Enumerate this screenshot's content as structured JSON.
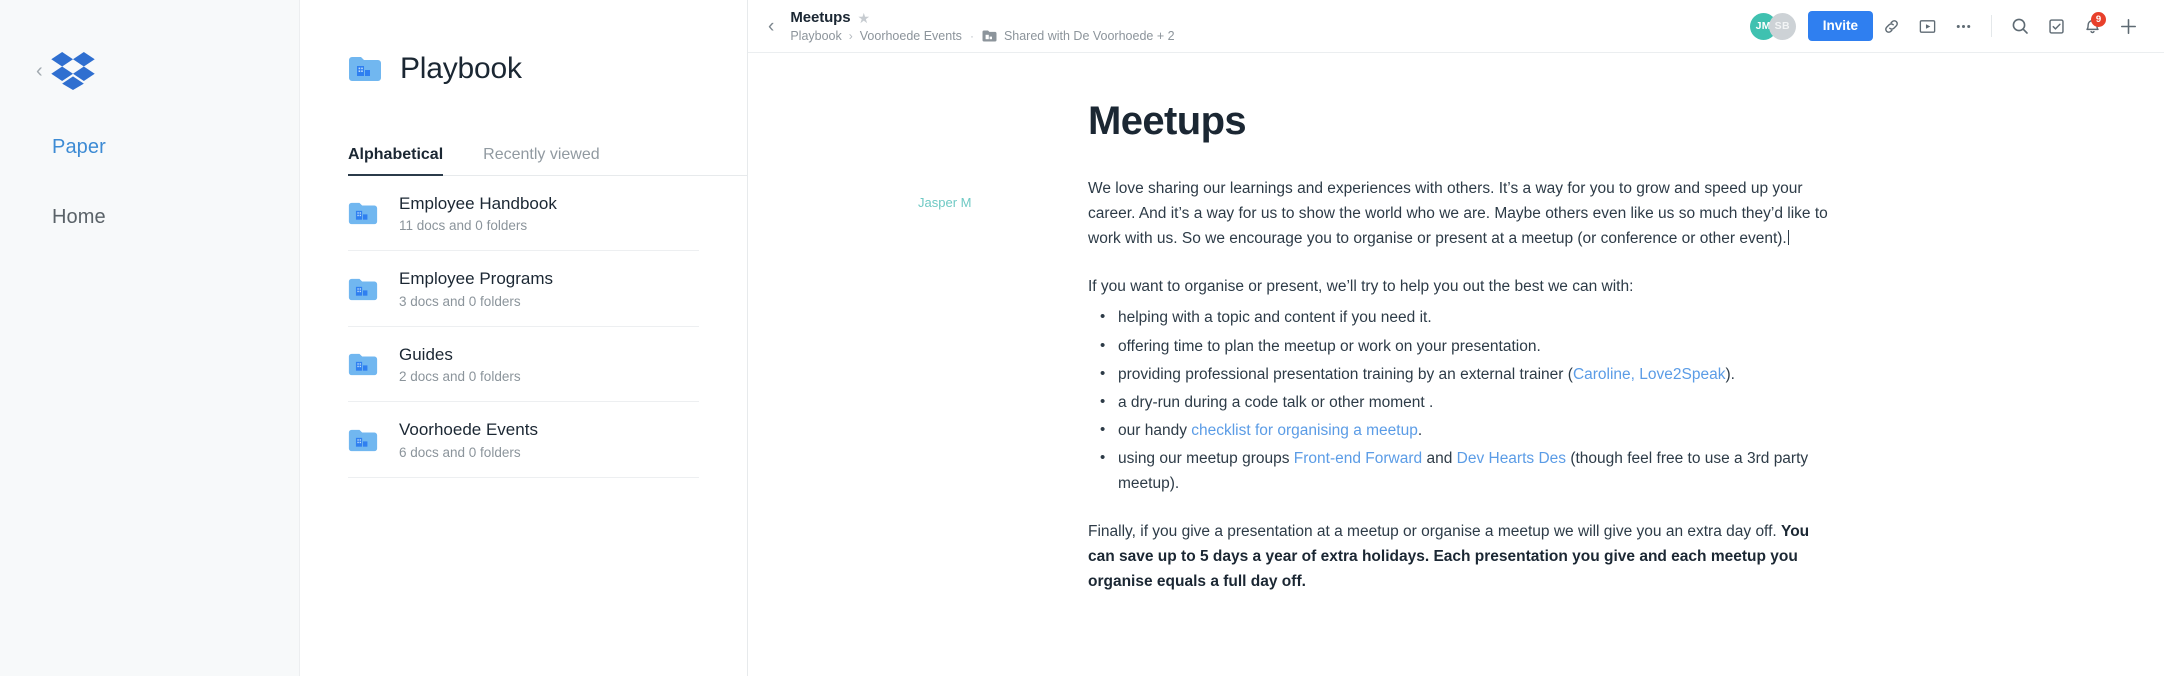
{
  "rail": {
    "collapse_icon": "chevron-left-icon",
    "logo": "dropbox-logo",
    "items": [
      {
        "label": "Paper",
        "active": true
      },
      {
        "label": "Home",
        "active": false
      }
    ]
  },
  "middle": {
    "folder_icon": "folder-icon",
    "title": "Playbook",
    "tabs": [
      {
        "label": "Alphabetical",
        "active": true
      },
      {
        "label": "Recently viewed",
        "active": false
      }
    ],
    "folders": [
      {
        "name": "Employee Handbook",
        "meta": "11 docs and 0 folders"
      },
      {
        "name": "Employee Programs",
        "meta": "3 docs and 0 folders"
      },
      {
        "name": "Guides",
        "meta": "2 docs and 0 folders"
      },
      {
        "name": "Voorhoede Events",
        "meta": "6 docs and 0 folders"
      }
    ]
  },
  "topbar": {
    "back_icon": "chevron-left-icon",
    "doc_name": "Meetups",
    "star_icon": "star-icon",
    "breadcrumb_root": "Playbook",
    "breadcrumb_sep": "›",
    "breadcrumb_parent": "Voorhoede Events",
    "breadcrumb_dot": "·",
    "shared_icon": "shared-folder-icon",
    "shared_label": "Shared with De Voorhoede + 2",
    "avatars": [
      {
        "initials": "JM",
        "color": "#3fc1b0"
      },
      {
        "initials": "SB",
        "color": "#cdd2d6"
      }
    ],
    "invite_label": "Invite",
    "invite_color": "#2f7ff0",
    "icons": [
      {
        "name": "link-icon"
      },
      {
        "name": "present-icon"
      },
      {
        "name": "more-horizontal-icon"
      },
      {
        "name": "search-icon"
      },
      {
        "name": "tasks-checkbox-icon"
      },
      {
        "name": "notifications-bell-icon"
      },
      {
        "name": "plus-icon"
      }
    ],
    "notification_count": "9",
    "notification_badge_color": "#e8402b"
  },
  "document": {
    "title": "Meetups",
    "author": "Jasper M",
    "paragraph_1": "We love sharing our learnings and experiences with others. It’s a way for you to grow and speed up your career. And it’s a way for us to show the world who we are. Maybe others even like us so much they’d like to work with us. So we encourage you to organise or present at a meetup (or conference or other event).",
    "paragraph_2": "If you want to organise or present, we’ll try to help you out the best we can with:",
    "bullets": [
      {
        "text": "helping with a topic and content if you need it."
      },
      {
        "text": "offering time to plan the meetup or work on your presentation."
      },
      {
        "pre": "providing professional presentation training by an external trainer (",
        "link": "Caroline, Love2Speak",
        "post": ")."
      },
      {
        "text": "a dry-run during a code talk or other moment ."
      },
      {
        "pre": "our handy ",
        "link": "checklist for organising a meetup",
        "post": "."
      },
      {
        "pre": "using our meetup groups ",
        "link": "Front-end Forward",
        "mid": " and ",
        "link2": "Dev Hearts Des",
        "post": " (though feel free to use a 3rd party meetup)."
      }
    ],
    "paragraph_3_plain": "Finally, if you give a presentation at a meetup or organise a meetup we will give you an extra day off. ",
    "paragraph_3_bold": "You can save up to 5 days a year of extra holidays. Each presentation you give and each meetup you organise equals a full day off.",
    "link_color": "#5b9ce6",
    "author_color": "#6fc9c4"
  }
}
